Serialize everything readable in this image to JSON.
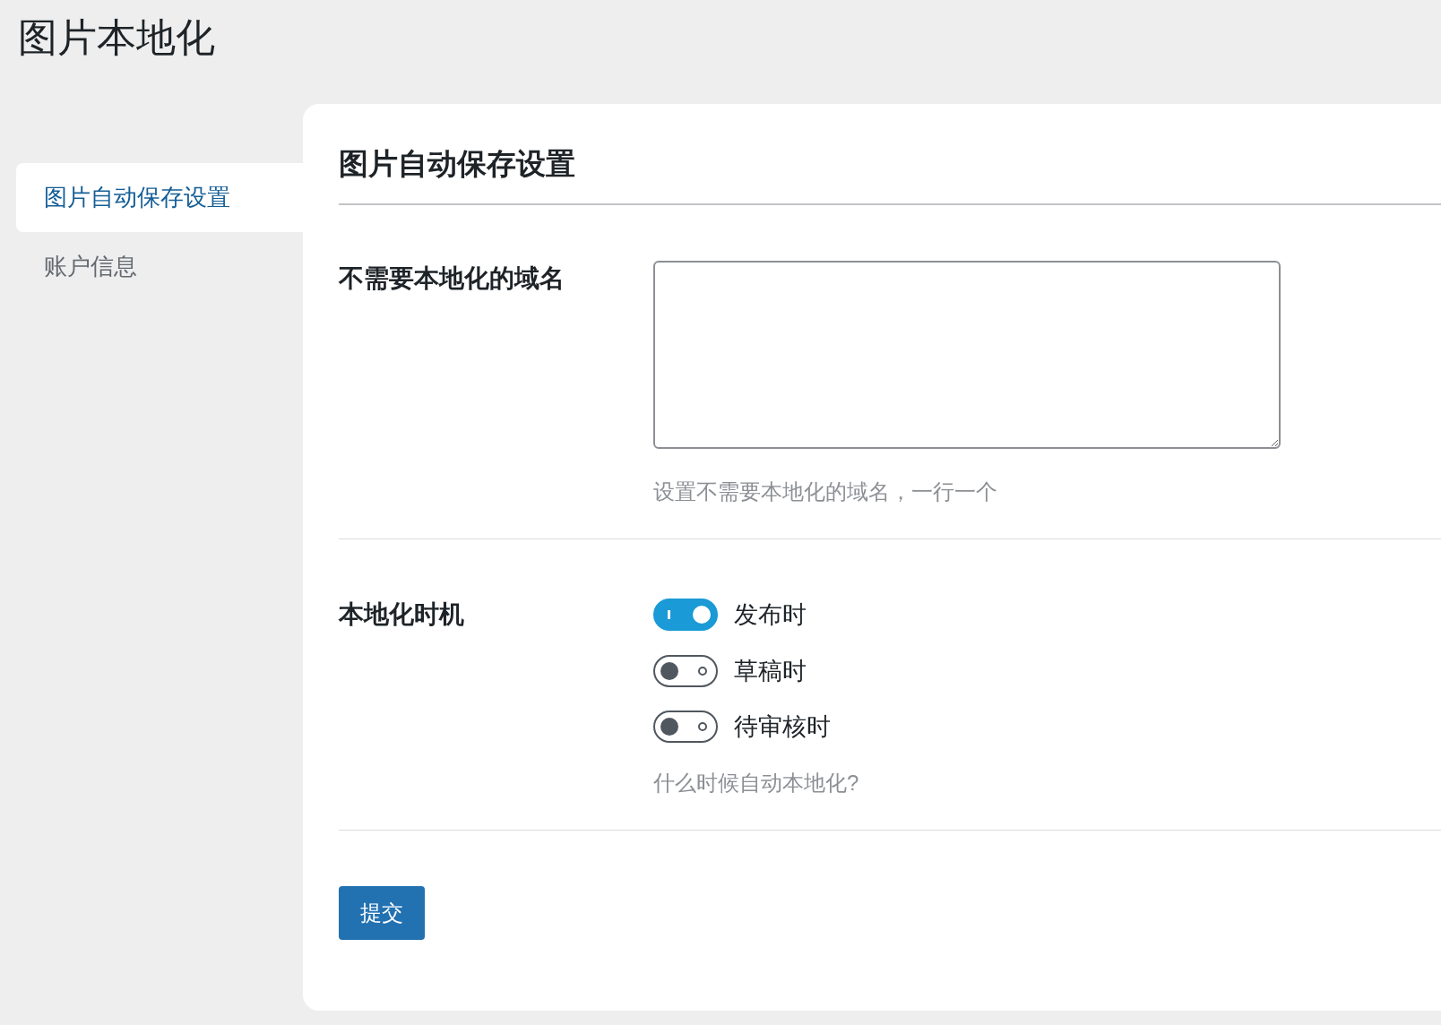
{
  "page_title": "图片本地化",
  "sidebar": {
    "items": [
      {
        "label": "图片自动保存设置",
        "selected": true
      },
      {
        "label": "账户信息",
        "selected": false
      }
    ]
  },
  "section_title": "图片自动保存设置",
  "domains_field": {
    "label": "不需要本地化的域名",
    "help": "设置不需要本地化的域名，一行一个"
  },
  "timing_field": {
    "label": "本地化时机",
    "options": [
      {
        "label": "发布时",
        "on": true
      },
      {
        "label": "草稿时",
        "on": false
      },
      {
        "label": "待审核时",
        "on": false
      }
    ],
    "help": "什么时候自动本地化?"
  },
  "submit_button": "提交"
}
